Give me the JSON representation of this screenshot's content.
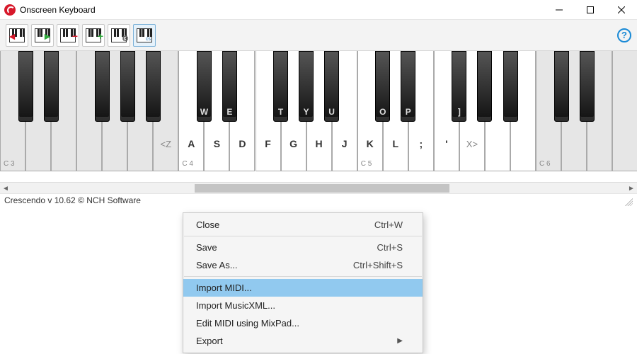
{
  "window": {
    "title": "Onscreen Keyboard"
  },
  "toolbar": {
    "buttons": [
      {
        "name": "octave-down",
        "accent": "#d7182a",
        "accentSide": "left"
      },
      {
        "name": "octave-up",
        "accent": "#2faa3b",
        "accentSide": "right"
      },
      {
        "name": "remove-octave",
        "accent": "#d7182a",
        "accentSide": "right",
        "accentChar": "−"
      },
      {
        "name": "add-octave",
        "accent": "#2faa3b",
        "accentSide": "right",
        "accentChar": "+"
      },
      {
        "name": "keyboard-settings",
        "gear": true
      },
      {
        "name": "toggle-labels",
        "active": true,
        "smallText": "cs"
      }
    ]
  },
  "piano": {
    "whiteWidth": 36.05,
    "octavesDim": [
      3,
      6
    ],
    "whiteKeys": [
      {
        "o": 3,
        "n": "C",
        "oct": "C 3"
      },
      {
        "o": 3,
        "n": "D"
      },
      {
        "o": 3,
        "n": "E"
      },
      {
        "o": 3,
        "n": "F"
      },
      {
        "o": 3,
        "n": "G"
      },
      {
        "o": 3,
        "n": "A"
      },
      {
        "o": 3,
        "n": "B",
        "nav": "<Z"
      },
      {
        "o": 4,
        "n": "C",
        "oct": "C 4",
        "lbl": "A"
      },
      {
        "o": 4,
        "n": "D",
        "lbl": "S"
      },
      {
        "o": 4,
        "n": "E",
        "lbl": "D"
      },
      {
        "o": 4,
        "n": "F",
        "lbl": "F"
      },
      {
        "o": 4,
        "n": "G",
        "lbl": "G"
      },
      {
        "o": 4,
        "n": "H",
        "lbl": "H"
      },
      {
        "o": 4,
        "n": "B",
        "lbl": "J"
      },
      {
        "o": 5,
        "n": "C",
        "oct": "C 5",
        "lbl": "K"
      },
      {
        "o": 5,
        "n": "D",
        "lbl": "L"
      },
      {
        "o": 5,
        "n": "E",
        "lbl": ";"
      },
      {
        "o": 5,
        "n": "F",
        "lbl": "'"
      },
      {
        "o": 5,
        "n": "G",
        "nav": "X>"
      },
      {
        "o": 5,
        "n": "A"
      },
      {
        "o": 5,
        "n": "B"
      },
      {
        "o": 6,
        "n": "C",
        "oct": "C 6"
      },
      {
        "o": 6,
        "n": "D"
      },
      {
        "o": 6,
        "n": "E"
      },
      {
        "o": 6,
        "n": "F"
      }
    ],
    "blackPattern": [
      0,
      1,
      3,
      4,
      5
    ],
    "blackLabels": {
      "7": "W",
      "8": "E",
      "10": "T",
      "11": "Y",
      "12": "U",
      "14": "O",
      "15": "P",
      "17": "]"
    }
  },
  "status": {
    "text": "Crescendo v 10.62 © NCH Software"
  },
  "menu": {
    "items": [
      {
        "label": "Close",
        "shortcut": "Ctrl+W"
      },
      {
        "sep": true
      },
      {
        "label": "Save",
        "shortcut": "Ctrl+S"
      },
      {
        "label": "Save As...",
        "shortcut": "Ctrl+Shift+S"
      },
      {
        "sep": true
      },
      {
        "label": "Import MIDI...",
        "selected": true
      },
      {
        "label": "Import MusicXML..."
      },
      {
        "label": "Edit MIDI using MixPad..."
      },
      {
        "label": "Export",
        "submenu": true
      }
    ]
  }
}
